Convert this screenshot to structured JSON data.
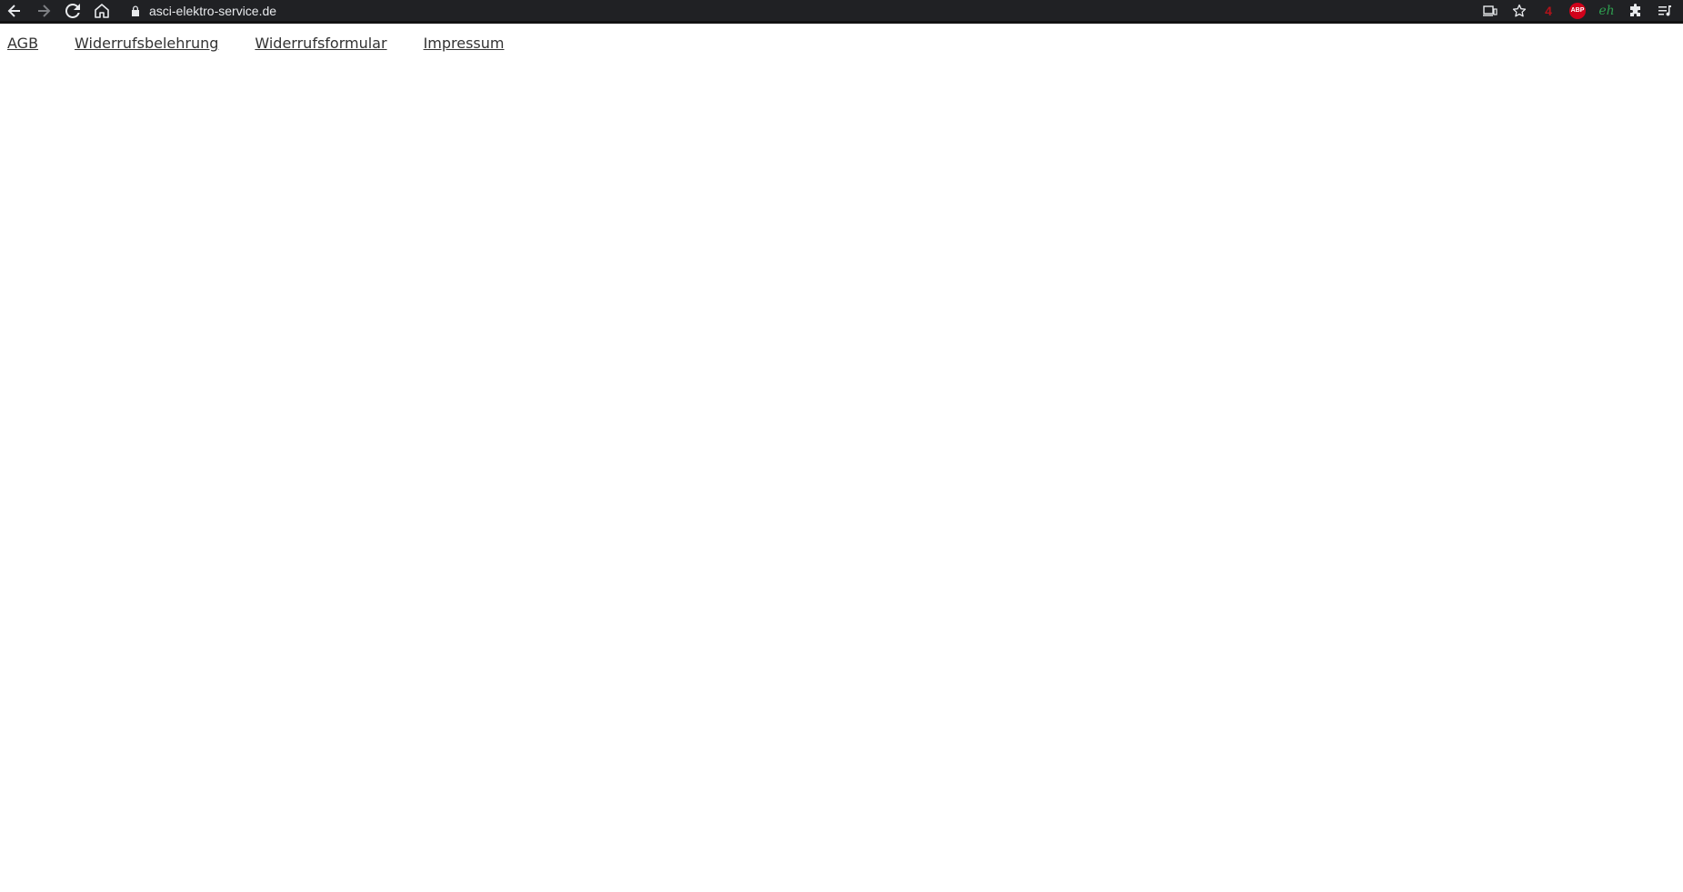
{
  "browser": {
    "url": "asci-elektro-service.de",
    "extensions": {
      "abp_label": "ABP",
      "eh_label": "eh",
      "red_ext_label": "4"
    }
  },
  "nav": {
    "links": [
      {
        "label": "AGB"
      },
      {
        "label": "Widerrufsbelehrung"
      },
      {
        "label": "Widerrufsformular"
      },
      {
        "label": "Impressum"
      }
    ]
  },
  "colors": {
    "toolbar_bg": "#202124",
    "link_color": "#333333",
    "page_bg": "#ffffff"
  }
}
